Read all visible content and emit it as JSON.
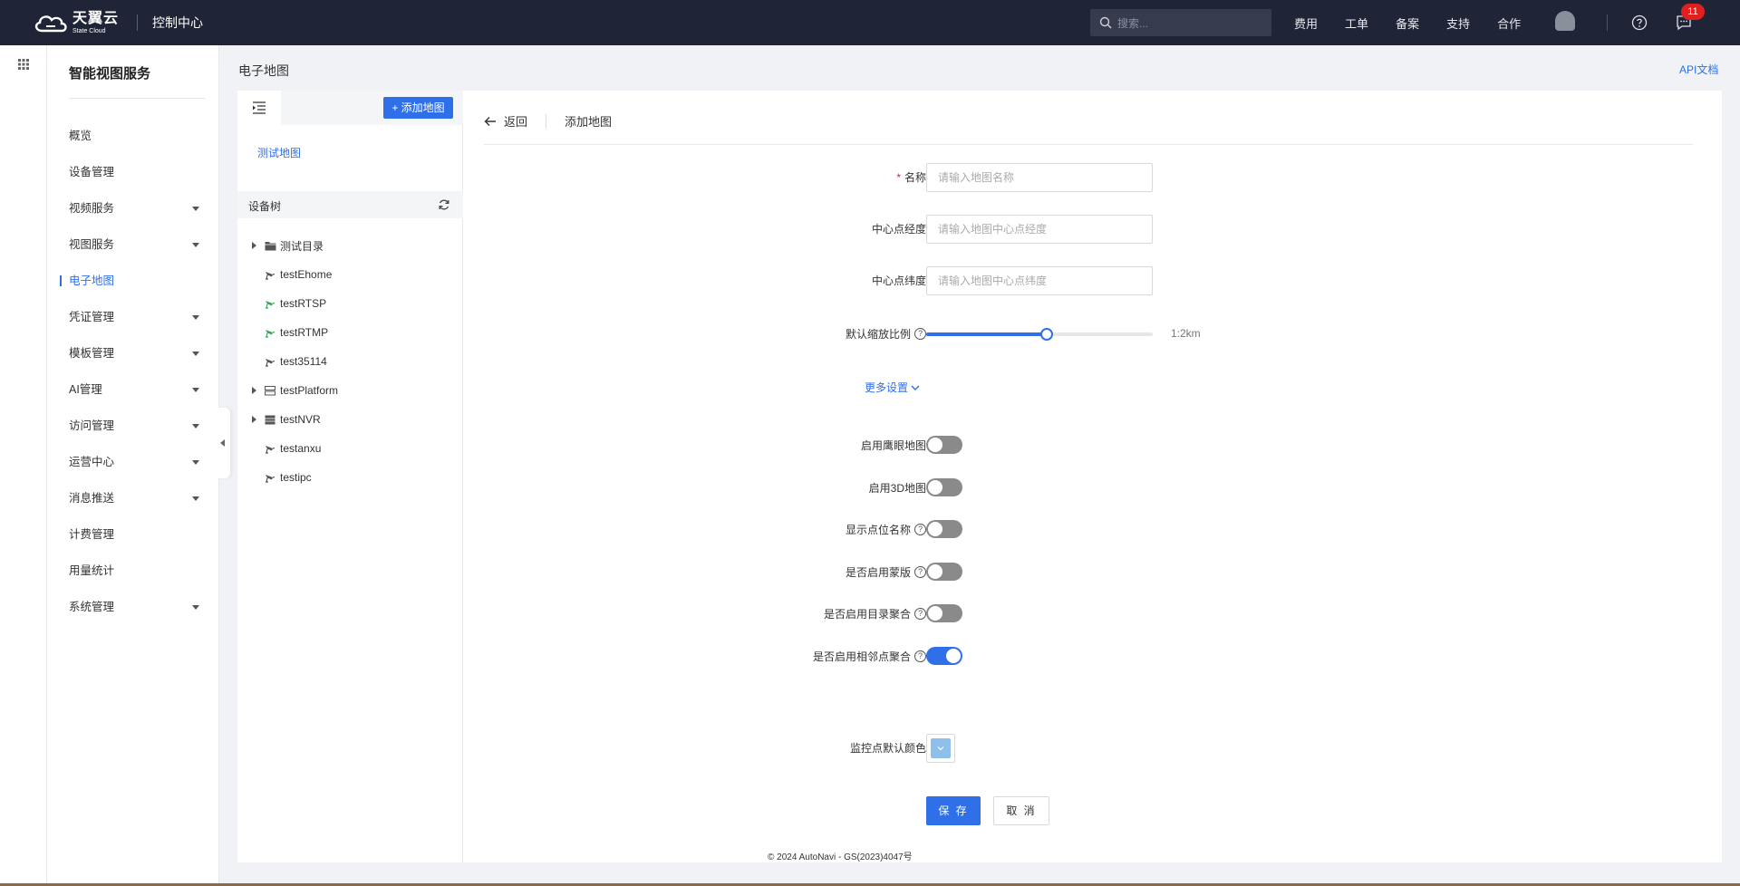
{
  "header": {
    "logo_cn": "天翼云",
    "logo_en": "State Cloud",
    "console_title": "控制中心",
    "search_placeholder": "搜索...",
    "nav": [
      "费用",
      "工单",
      "备案",
      "支持",
      "合作"
    ],
    "message_count": "11"
  },
  "sidebar": {
    "title": "智能视图服务",
    "items": [
      {
        "label": "概览",
        "caret": false,
        "active": false
      },
      {
        "label": "设备管理",
        "caret": false,
        "active": false
      },
      {
        "label": "视频服务",
        "caret": true,
        "active": false
      },
      {
        "label": "视图服务",
        "caret": true,
        "active": false
      },
      {
        "label": "电子地图",
        "caret": false,
        "active": true
      },
      {
        "label": "凭证管理",
        "caret": true,
        "active": false
      },
      {
        "label": "模板管理",
        "caret": true,
        "active": false
      },
      {
        "label": "AI管理",
        "caret": true,
        "active": false
      },
      {
        "label": "访问管理",
        "caret": true,
        "active": false
      },
      {
        "label": "运营中心",
        "caret": true,
        "active": false
      },
      {
        "label": "消息推送",
        "caret": true,
        "active": false
      },
      {
        "label": "计费管理",
        "caret": false,
        "active": false
      },
      {
        "label": "用量统计",
        "caret": false,
        "active": false
      },
      {
        "label": "系统管理",
        "caret": true,
        "active": false
      }
    ]
  },
  "page": {
    "title": "电子地图",
    "api_link": "API文档"
  },
  "left_panel": {
    "add_map_label": "+ 添加地图",
    "maps": [
      "测试地图"
    ],
    "tree_title": "设备树",
    "tree": [
      {
        "label": "测试目录",
        "expandable": true,
        "icon": "folder-icon",
        "color": "#555555"
      },
      {
        "label": "testEhome",
        "expandable": false,
        "icon": "camera-icon",
        "color": "#555555"
      },
      {
        "label": "testRTSP",
        "expandable": false,
        "icon": "camera-icon",
        "color": "#3aa65a"
      },
      {
        "label": "testRTMP",
        "expandable": false,
        "icon": "camera-icon",
        "color": "#3aa65a"
      },
      {
        "label": "test35114",
        "expandable": false,
        "icon": "camera-icon",
        "color": "#555555"
      },
      {
        "label": "testPlatform",
        "expandable": true,
        "icon": "server-icon",
        "color": "#555555"
      },
      {
        "label": "testNVR",
        "expandable": true,
        "icon": "nvr-icon",
        "color": "#555555"
      },
      {
        "label": "testanxu",
        "expandable": false,
        "icon": "camera-icon",
        "color": "#555555"
      },
      {
        "label": "testipc",
        "expandable": false,
        "icon": "camera-icon",
        "color": "#555555"
      }
    ]
  },
  "form": {
    "back_label": "返回",
    "title": "添加地图",
    "name_label": "名称",
    "name_placeholder": "请输入地图名称",
    "lng_label": "中心点经度",
    "lng_placeholder": "请输入地图中心点经度",
    "lat_label": "中心点纬度",
    "lat_placeholder": "请输入地图中心点纬度",
    "zoom_label": "默认缩放比例",
    "zoom_value_text": "1:2km",
    "zoom_fraction": 0.53,
    "more_settings": "更多设置",
    "switches": [
      {
        "label": "启用鹰眼地图",
        "help": false,
        "on": false
      },
      {
        "label": "启用3D地图",
        "help": false,
        "on": false
      },
      {
        "label": "显示点位名称",
        "help": true,
        "on": false
      },
      {
        "label": "是否启用蒙版",
        "help": true,
        "on": false
      },
      {
        "label": "是否启用目录聚合",
        "help": true,
        "on": false
      },
      {
        "label": "是否启用相邻点聚合",
        "help": true,
        "on": true
      }
    ],
    "color_label": "监控点默认颜色",
    "default_color": "#8fc0ec",
    "save_label": "保 存",
    "cancel_label": "取 消",
    "copyright": "© 2024 AutoNavi - GS(2023)4047号"
  },
  "colors": {
    "accent": "#2f6fe8",
    "topbar": "#1f2537"
  }
}
